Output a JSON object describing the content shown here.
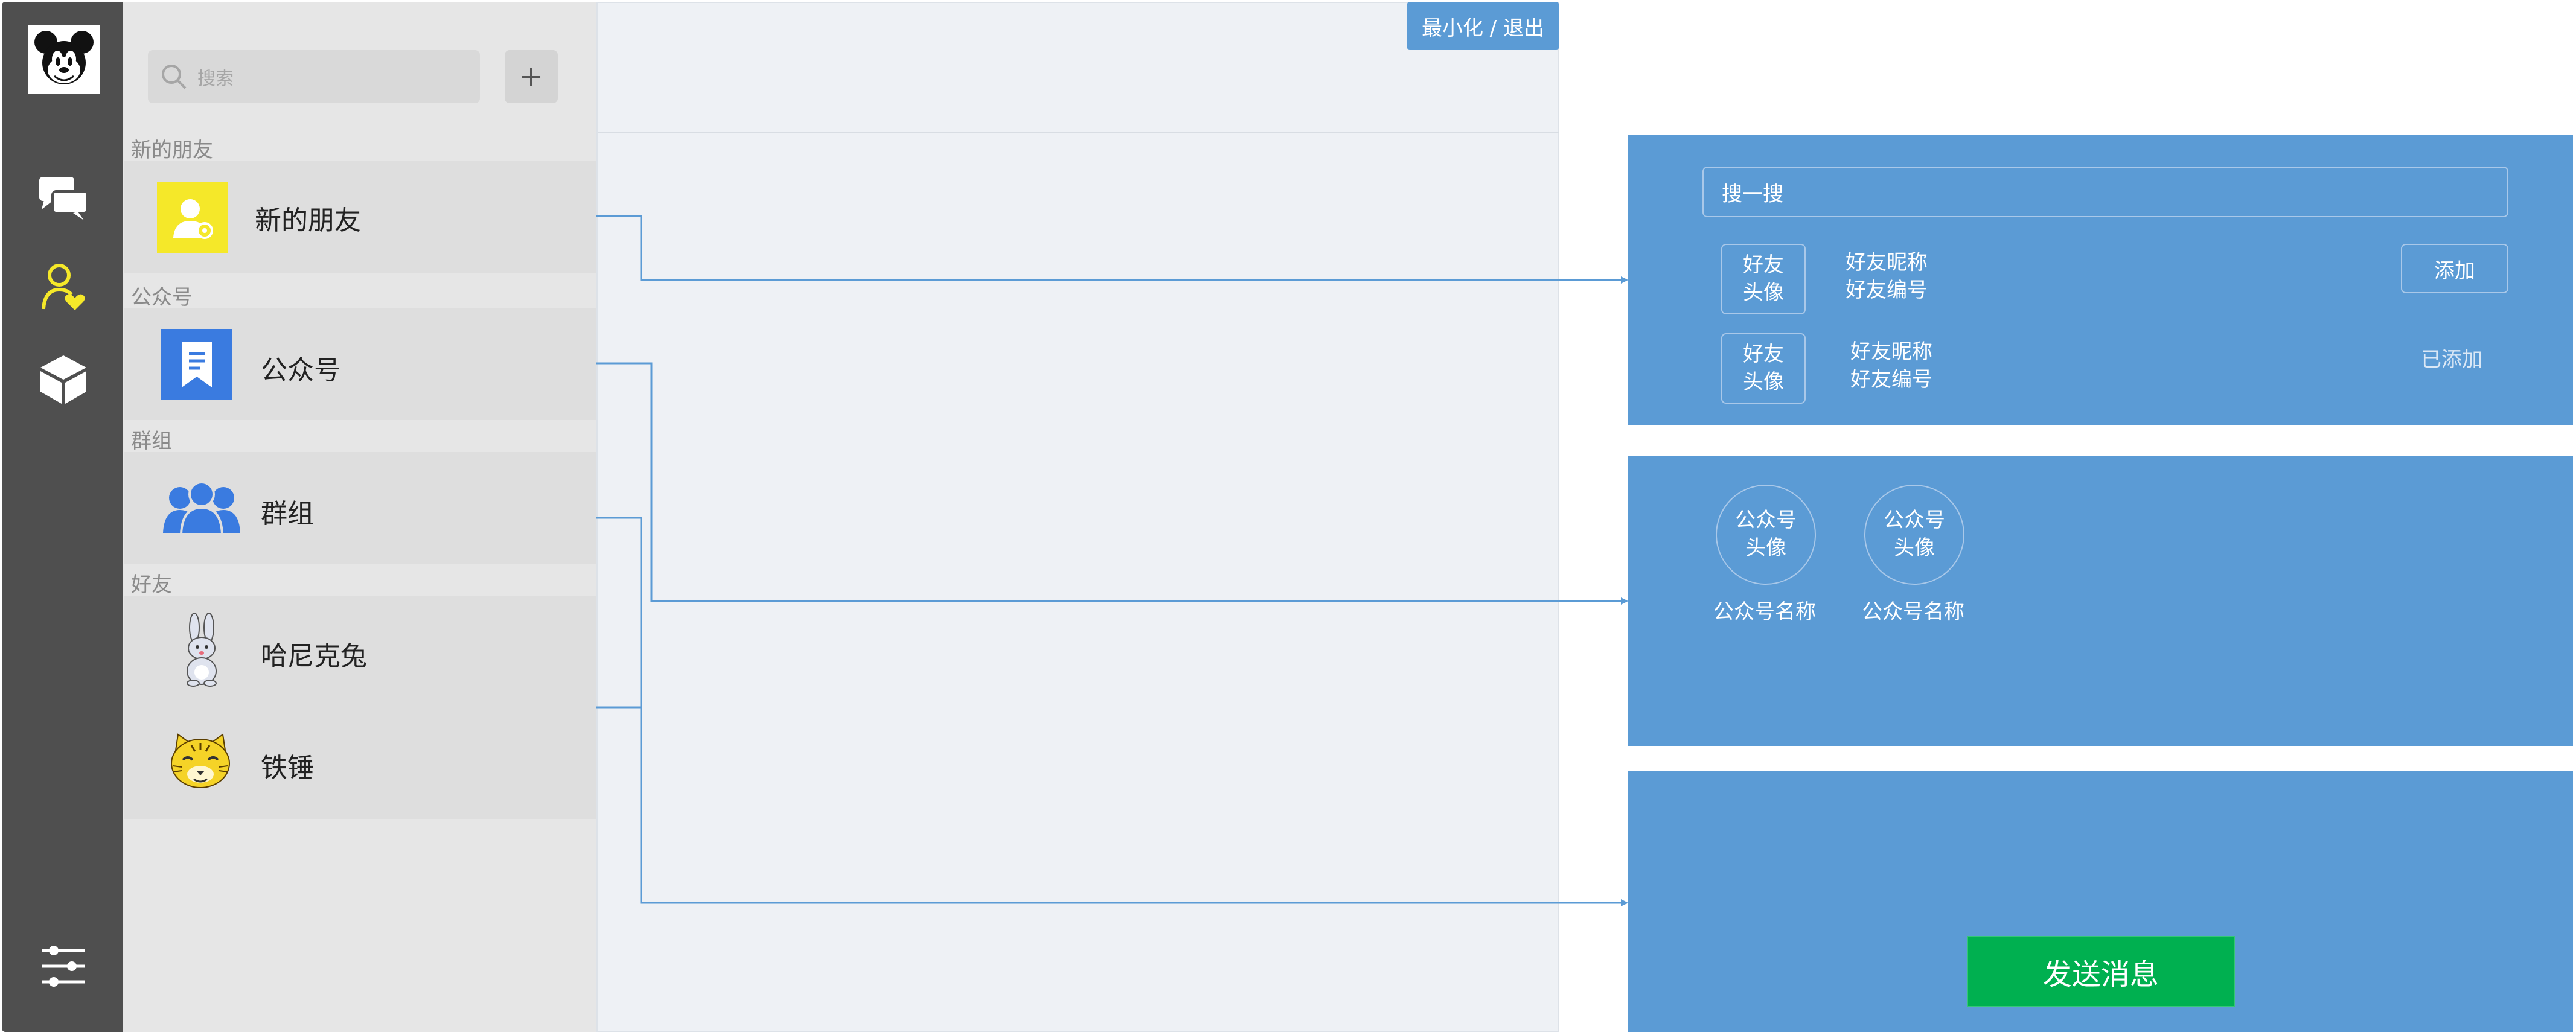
{
  "window": {
    "minimize_exit_label": "最小化 / 退出"
  },
  "search": {
    "placeholder": "搜索",
    "add_button": "+"
  },
  "sections": {
    "new_friends_header": "新的朋友",
    "official_header": "公众号",
    "groups_header": "群组",
    "friends_header": "好友"
  },
  "list": {
    "new_friends": "新的朋友",
    "official_accounts": "公众号",
    "groups": "群组",
    "friends": [
      "哈尼克兔",
      "铁锤"
    ]
  },
  "new_friend_panel": {
    "search_label": "搜一搜",
    "rows": [
      {
        "avatar_line1": "好友",
        "avatar_line2": "头像",
        "nickname": "好友昵称",
        "number": "好友编号",
        "action": "添加"
      },
      {
        "avatar_line1": "好友",
        "avatar_line2": "头像",
        "nickname": "好友昵称",
        "number": "好友编号",
        "action": "已添加"
      }
    ]
  },
  "official_panel": {
    "items": [
      {
        "avatar_line1": "公众号",
        "avatar_line2": "头像",
        "name": "公众号名称"
      },
      {
        "avatar_line1": "公众号",
        "avatar_line2": "头像",
        "name": "公众号名称"
      }
    ]
  },
  "group_panel": {
    "send_label": "发送消息"
  },
  "colors": {
    "nav_bg": "#4f4f4f",
    "panel_blue": "#5b9bd5",
    "send_green": "#00b050",
    "icon_yellow": "#f5e829",
    "icon_blue": "#3a7be0"
  },
  "icons": [
    "mickey-avatar-icon",
    "chat-icon",
    "contacts-icon",
    "box-icon",
    "settings-icon",
    "search-icon",
    "new-friend-icon",
    "official-account-icon",
    "group-icon",
    "rabbit-avatar-icon",
    "tiger-avatar-icon"
  ]
}
